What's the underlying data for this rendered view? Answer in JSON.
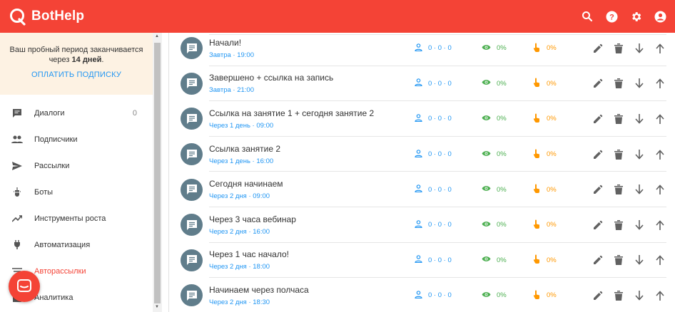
{
  "app": {
    "name": "BotHelp"
  },
  "topbar": {
    "icons": [
      "search-icon",
      "help-icon",
      "gear-icon",
      "account-icon"
    ]
  },
  "trial": {
    "line1": "Ваш пробный период заканчивается",
    "line2_prefix": "через ",
    "days": "14 дней",
    "line2_suffix": ".",
    "pay_link": "ОПЛАТИТЬ ПОДПИСКУ"
  },
  "nav": {
    "items": [
      {
        "label": "Диалоги",
        "count": "0",
        "icon": "chat-icon"
      },
      {
        "label": "Подписчики",
        "count": "",
        "icon": "people-icon"
      },
      {
        "label": "Рассылки",
        "count": "",
        "icon": "send-icon"
      },
      {
        "label": "Боты",
        "count": "",
        "icon": "bot-icon"
      },
      {
        "label": "Инструменты роста",
        "count": "",
        "icon": "trending-up-icon"
      },
      {
        "label": "Автоматизация",
        "count": "",
        "icon": "plug-icon"
      },
      {
        "label": "Авторассылки",
        "count": "",
        "icon": "list-icon",
        "active": true
      },
      {
        "label": "Аналитика",
        "count": "",
        "icon": "analytics-icon"
      }
    ]
  },
  "colors": {
    "brand": "#f44336",
    "link": "#2196f3",
    "views": "#4caf50",
    "clicks": "#ff9800",
    "msg_icon": "#607d8b"
  },
  "messages": [
    {
      "title": "Начали!",
      "schedule": "Завтра · 19:00",
      "users": "0 · 0 · 0",
      "views": "0%",
      "clicks": "0%"
    },
    {
      "title": "Завершено + ссылка на запись",
      "schedule": "Завтра · 21:00",
      "users": "0 · 0 · 0",
      "views": "0%",
      "clicks": "0%"
    },
    {
      "title": "Ссылка на занятие 1 + сегодня занятие 2",
      "schedule": "Через 1 день · 09:00",
      "users": "0 · 0 · 0",
      "views": "0%",
      "clicks": "0%"
    },
    {
      "title": "Ссылка занятие 2",
      "schedule": "Через 1 день · 16:00",
      "users": "0 · 0 · 0",
      "views": "0%",
      "clicks": "0%"
    },
    {
      "title": "Сегодня начинаем",
      "schedule": "Через 2 дня · 09:00",
      "users": "0 · 0 · 0",
      "views": "0%",
      "clicks": "0%"
    },
    {
      "title": "Через 3 часа вебинар",
      "schedule": "Через 2 дня · 16:00",
      "users": "0 · 0 · 0",
      "views": "0%",
      "clicks": "0%"
    },
    {
      "title": "Через 1 час начало!",
      "schedule": "Через 2 дня · 18:00",
      "users": "0 · 0 · 0",
      "views": "0%",
      "clicks": "0%"
    },
    {
      "title": "Начинаем через полчаса",
      "schedule": "Через 2 дня · 18:30",
      "users": "0 · 0 · 0",
      "views": "0%",
      "clicks": "0%"
    }
  ]
}
